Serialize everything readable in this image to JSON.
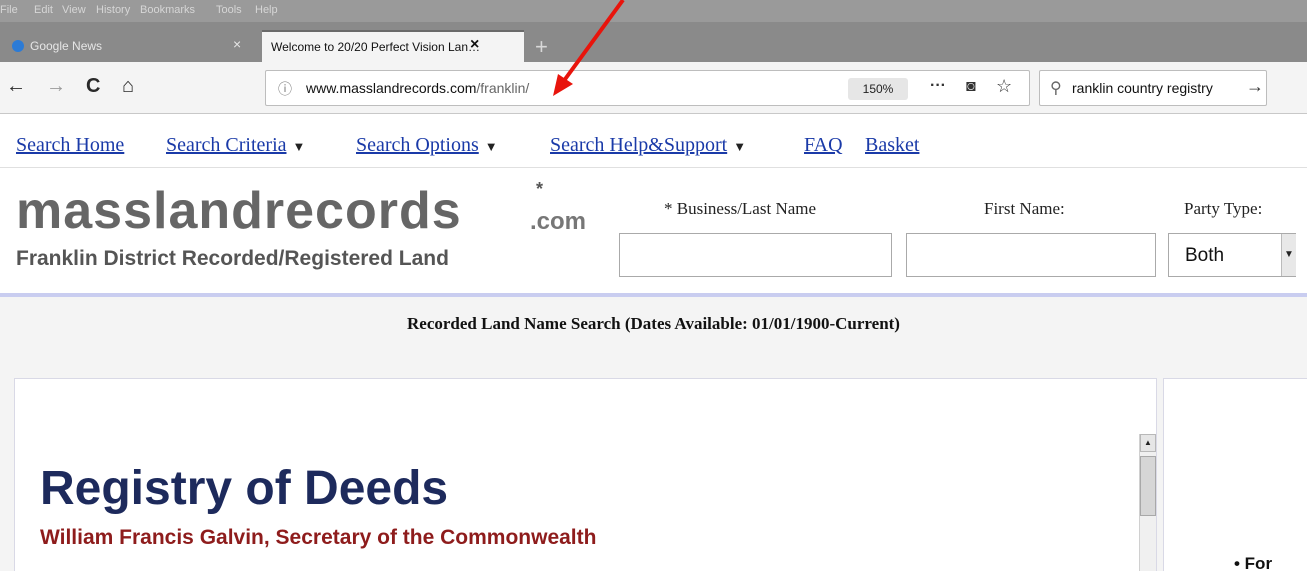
{
  "browser": {
    "menu": [
      "File",
      "Edit",
      "View",
      "History",
      "Bookmarks",
      "Tools",
      "Help"
    ],
    "tabs": [
      {
        "title": "Google News",
        "active": false
      },
      {
        "title": "Welcome to 20/20 Perfect Vision Lan…",
        "active": true
      }
    ],
    "new_tab_glyph": "+",
    "close_glyph": "×",
    "nav": {
      "back": "←",
      "forward": "→",
      "reload": "C",
      "home": "⌂"
    },
    "url": {
      "info_glyph": "ⓘ",
      "domain": "www.masslandrecords.com",
      "path": "/franklin/"
    },
    "zoom": "150%",
    "page_actions": {
      "dots": "···",
      "pocket": "◙",
      "star": "☆"
    },
    "search": {
      "glyph": "⚲",
      "query": "ranklin country registry",
      "go": "→"
    }
  },
  "site_nav": {
    "links": [
      {
        "label": "Search Home",
        "dropdown": false
      },
      {
        "label": "Search Criteria",
        "dropdown": true
      },
      {
        "label": "Search Options",
        "dropdown": true
      },
      {
        "label": "Search Help&Support",
        "dropdown": true
      },
      {
        "label": "FAQ",
        "dropdown": false
      },
      {
        "label": "Basket",
        "dropdown": false
      }
    ],
    "caret": "▼"
  },
  "header": {
    "logo": "masslandrecords",
    "logo_suffix": ".com",
    "logo_star": "*",
    "subtitle": "Franklin District Recorded/Registered Land"
  },
  "search_form": {
    "last_name_label": "* Business/Last Name",
    "first_name_label": "First Name:",
    "party_type_label": "Party Type:",
    "last_name_value": "",
    "first_name_value": "",
    "party_type_value": "Both"
  },
  "page_subtitle": "Recorded Land Name Search (Dates Available: 01/01/1900-Current)",
  "content": {
    "title": "Registry of Deeds",
    "subtitle": "William Francis Galvin, Secretary of the Commonwealth",
    "side_bullet": "• For"
  },
  "colors": {
    "link": "#1a3aa8",
    "title_navy": "#1d2a5c",
    "subtitle_red": "#8e1c1c",
    "annotation_arrow": "#e8140c"
  }
}
